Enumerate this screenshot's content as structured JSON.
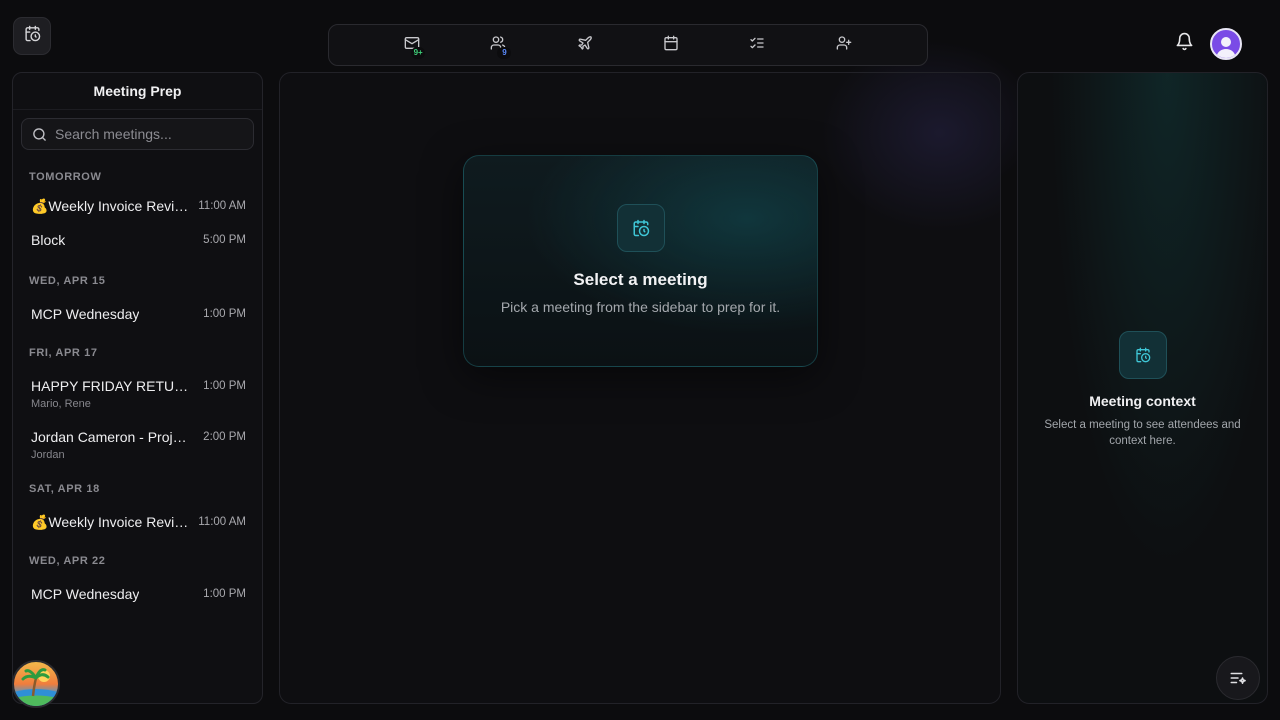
{
  "app": {
    "logo_icon": "calendar-clock-icon"
  },
  "topnav": {
    "items": [
      {
        "icon": "mail-icon",
        "badge": "9+",
        "badge_color": "#3fd07a"
      },
      {
        "icon": "users-icon",
        "badge": "9",
        "badge_color": "#5b8cff"
      },
      {
        "icon": "plane-icon"
      },
      {
        "icon": "calendar-icon"
      },
      {
        "icon": "checklist-icon"
      },
      {
        "icon": "user-plus-icon"
      }
    ]
  },
  "header": {
    "bell_icon": "bell-icon",
    "avatar_color": "#7a4be6"
  },
  "sidebar": {
    "title": "Meeting Prep",
    "search_placeholder": "Search meetings...",
    "sections": [
      {
        "label": "TOMORROW",
        "meetings": [
          {
            "title": "💰Weekly Invoice Revie...",
            "time": "11:00 AM"
          },
          {
            "title": "Block",
            "time": "5:00 PM"
          }
        ]
      },
      {
        "label": "WED, APR 15",
        "meetings": [
          {
            "title": "MCP Wednesday",
            "time": "1:00 PM"
          }
        ]
      },
      {
        "label": "FRI, APR 17",
        "meetings": [
          {
            "title": "HAPPY FRIDAY RETURNS",
            "time": "1:00 PM",
            "attendees": "Mario, Rene"
          },
          {
            "title": "Jordan Cameron - Proje...",
            "time": "2:00 PM",
            "attendees": "Jordan"
          }
        ]
      },
      {
        "label": "SAT, APR 18",
        "meetings": [
          {
            "title": "💰Weekly Invoice Revie...",
            "time": "11:00 AM"
          }
        ]
      },
      {
        "label": "WED, APR 22",
        "meetings": [
          {
            "title": "MCP Wednesday",
            "time": "1:00 PM"
          }
        ]
      }
    ]
  },
  "main": {
    "empty_title": "Select a meeting",
    "empty_subtitle": "Pick a meeting from the sidebar to prep for it.",
    "accent": "#3fc6d6"
  },
  "context": {
    "title": "Meeting context",
    "subtitle": "Select a meeting to see attendees and context here."
  }
}
